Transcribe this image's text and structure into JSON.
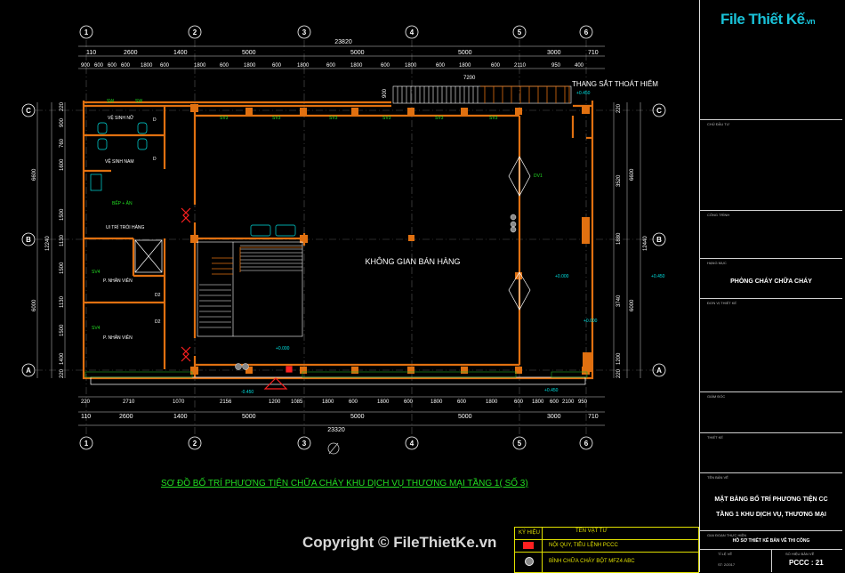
{
  "grid": {
    "columns": [
      "1",
      "2",
      "3",
      "4",
      "5",
      "6"
    ],
    "rows": [
      "C",
      "B",
      "A"
    ]
  },
  "dims": {
    "top_total": "23820",
    "top_row1": [
      "110",
      "2600",
      "1400",
      "5000",
      "5000",
      "5000",
      "3000",
      "710"
    ],
    "top_row2": [
      "900",
      "600",
      "600",
      "600",
      "1800",
      "600",
      "1800",
      "600",
      "1800",
      "600",
      "1800",
      "600",
      "1800",
      "600",
      "1800",
      "600",
      "1800",
      "600",
      "2110",
      "950",
      "400"
    ],
    "top_stair": "7200",
    "top_left_small": "900",
    "bottom_row1": [
      "220",
      "2710",
      "1070",
      "2156",
      "1200",
      "1085",
      "1800",
      "600",
      "1800",
      "600",
      "1800",
      "600",
      "1800",
      "600",
      "1800",
      "600",
      "2100",
      "950"
    ],
    "bottom_row2": [
      "110",
      "2600",
      "1400",
      "5000",
      "5000",
      "5000",
      "3000",
      "710"
    ],
    "bottom_total": "23320",
    "left_outer": [
      "6600",
      "6000"
    ],
    "left_inner": [
      "12240",
      "1500",
      "1130",
      "1500",
      "1400",
      "1500",
      "900",
      "760",
      "1130",
      "1600",
      "220",
      "220"
    ],
    "right_outer": [
      "6600",
      "6000",
      "12440"
    ],
    "right_inner": [
      "3520",
      "1880",
      "3740",
      "1200",
      "220",
      "220"
    ]
  },
  "levels": {
    "stair_top": "+0.450",
    "right_mid": "+0.450",
    "center": "+0.000",
    "center_lower": "+0.000",
    "right_lower": "+0.000",
    "bottom_left": "-0.450",
    "bottom_right": "+0.450"
  },
  "rooms": {
    "wc_nu": "VỆ SINH NỮ",
    "wc_nam": "VỆ SINH NAM",
    "bep": "BẾP + ĂN",
    "ui": "UI TRÍ TRÒI HÀNG",
    "nv1": "P. NHÂN VIÊN",
    "nv2": "P. NHÂN VIÊN",
    "main": "KHÔNG GIAN BÁN HÀNG",
    "stair": "THANG SẮT THOÁT HIỂM"
  },
  "tags": {
    "sw": "SW",
    "d": "D",
    "sv3": "SV3",
    "sv4": "SV4",
    "d2": "D2",
    "dv1": "DV1"
  },
  "plan_title": "SƠ ĐỒ BỐ TRÍ PHƯƠNG TIỆN CHỮA CHÁY KHU DỊCH VỤ THƯƠNG MẠI TẦNG 1( SỐ 3)",
  "legend": {
    "col1": "KÝ HIỆU",
    "col2": "TÊN VẬT TƯ",
    "row1": "NỘI QUY, TIÊU LỆNH PCCC",
    "row2": "BÌNH CHỮA CHÁY BỘT MFZ4 ABC"
  },
  "title_block": {
    "logo": "File Thiết Kế",
    "logo_suffix": ".vn",
    "cap1": "CHỦ ĐẦU TƯ",
    "cap2": "CÔNG TRÌNH",
    "cap3": "HẠNG MỤC",
    "item": "PHÒNG CHÁY CHỮA CHÁY",
    "cap4": "ĐƠN VỊ THIẾT KẾ",
    "cap5": "GIÁM ĐỐC",
    "cap6": "THIẾT KẾ",
    "cap7": "TÊN BẢN VẼ",
    "sheet_title_1": "MẶT BẰNG BỐ TRÍ PHƯƠNG TIỆN CC",
    "sheet_title_2": "TẦNG 1 KHU DỊCH VỤ, THƯƠNG MẠI",
    "cap8": "GIAI ĐOẠN THỰC HIỆN",
    "phase": "HỒ SƠ THIẾT KẾ BẢN VẼ THI CÔNG",
    "scale_label": "TỈ LỆ VẼ",
    "sheet_no_label": "SỐ HIỆU BẢN VẼ",
    "date": "ST: 2/2017",
    "sheet_no": "PCCC : 21"
  },
  "copyright": "Copyright © FileThietKe.vn",
  "colors": {
    "background": "#000000",
    "wall": "#e07010",
    "dimension": "#ffffff",
    "grid_bubble": "#ffffff",
    "text_green": "#22dd22",
    "cyan": "#00e0e0",
    "yellow": "#e0e000",
    "red_symbol": "#ff2020",
    "brand": "#19c2d8"
  }
}
